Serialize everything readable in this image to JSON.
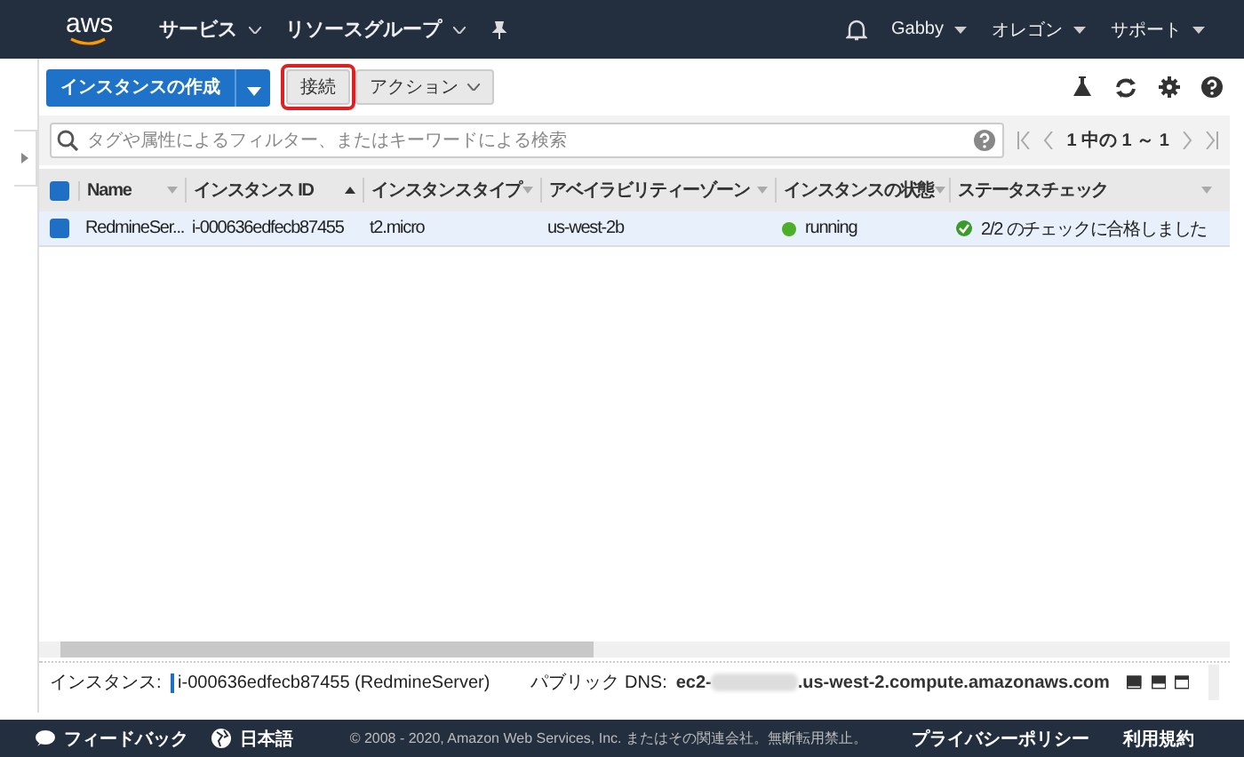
{
  "nav": {
    "logo": "aws",
    "menus": [
      {
        "label": "サービス"
      },
      {
        "label": "リソースグループ"
      }
    ],
    "right": [
      {
        "label": "Gabby"
      },
      {
        "label": "オレゴン"
      },
      {
        "label": "サポート"
      }
    ]
  },
  "toolbar": {
    "create": "インスタンスの作成",
    "connect": "接続",
    "actions": "アクション"
  },
  "search": {
    "placeholder": "タグや属性によるフィルター、またはキーワードによる検索"
  },
  "pager": "1 中の 1 ～ 1",
  "table": {
    "all_selected": true,
    "columns": [
      {
        "label": "Name",
        "sorted": false
      },
      {
        "label": "インスタンス ID",
        "sorted": true
      },
      {
        "label": "インスタンスタイプ",
        "sorted": false
      },
      {
        "label": "アベイラビリティーゾーン",
        "sorted": false
      },
      {
        "label": "インスタンスの状態",
        "sorted": false
      },
      {
        "label": "ステータスチェック",
        "sorted": false
      }
    ],
    "rows": [
      {
        "selected": true,
        "cells": [
          "RedmineSer...",
          "i-000636edfecb87455",
          "t2.micro",
          "us-west-2b",
          "running",
          "2/2 のチェックに合格しました"
        ],
        "color": "#4caf28"
      }
    ]
  },
  "detail": {
    "instance_label": "インスタンス:",
    "instance_value": "i-000636edfecb87455 (RedmineServer)",
    "dns_label": "パブリック DNS:",
    "dns_start": "ec2-",
    "dns_end": ".us-west-2.compute.amazonaws.com"
  },
  "footer": {
    "feedback": "フィードバック",
    "language": "日本語",
    "copyright": "© 2008 - 2020, Amazon Web Services, Inc. またはその関連会社。無断転用禁止。",
    "links": [
      "プライバシーポリシー",
      "利用規約"
    ]
  }
}
